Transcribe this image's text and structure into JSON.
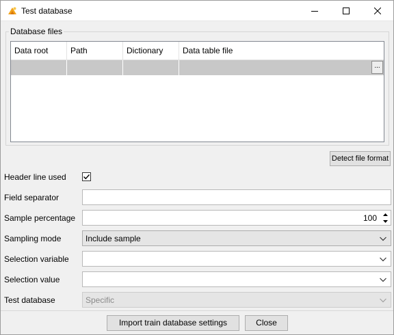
{
  "window": {
    "title": "Test database",
    "icon": "app-logo-icon"
  },
  "database_files": {
    "group_label": "Database files",
    "columns": [
      "Data root",
      "Path",
      "Dictionary",
      "Data table file"
    ],
    "browse_label": "..."
  },
  "buttons": {
    "detect_file_format": "Detect file format",
    "import_train_settings": "Import train database settings",
    "close": "Close"
  },
  "form": {
    "header_line_used": {
      "label": "Header line used",
      "checked": true
    },
    "field_separator": {
      "label": "Field separator",
      "value": ""
    },
    "sample_percentage": {
      "label": "Sample percentage",
      "value": "100"
    },
    "sampling_mode": {
      "label": "Sampling mode",
      "value": "Include sample"
    },
    "selection_variable": {
      "label": "Selection variable",
      "value": ""
    },
    "selection_value": {
      "label": "Selection value",
      "value": ""
    },
    "test_database": {
      "label": "Test database",
      "value": "Specific"
    }
  },
  "colors": {
    "window_bg": "#f0f0f0",
    "row_fill": "#c8c8c8",
    "button_bg": "#e1e1e1"
  }
}
